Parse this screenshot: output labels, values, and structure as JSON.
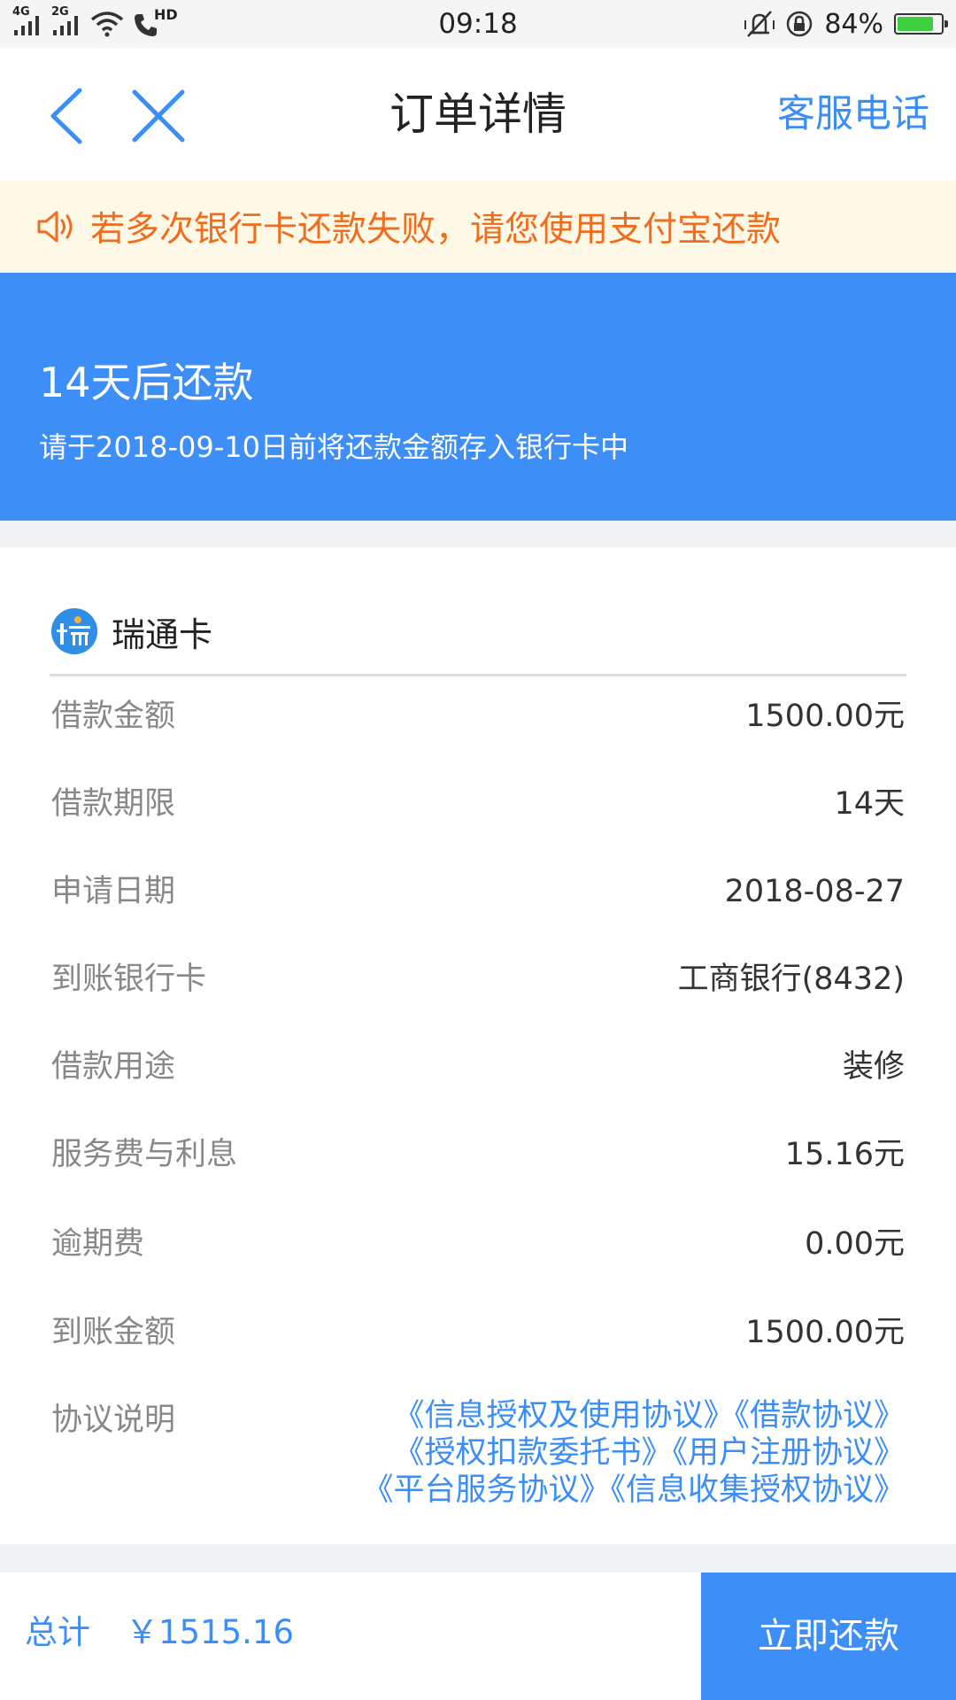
{
  "status_bar": {
    "time": "09:18",
    "battery": "84%",
    "battery_level": 0.84,
    "network_1": "4G",
    "network_2": "2G",
    "call_badge": "HD"
  },
  "nav": {
    "title": "订单详情",
    "right_link": "客服电话"
  },
  "notice": {
    "text": "若多次银行卡还款失败，请您使用支付宝还款"
  },
  "banner": {
    "title": "14天后还款",
    "subtitle": "请于2018-09-10日前将还款金额存入银行卡中"
  },
  "card": {
    "name": "瑞通卡",
    "rows": [
      {
        "label": "借款金额",
        "value": "1500.00元"
      },
      {
        "label": "借款期限",
        "value": "14天"
      },
      {
        "label": "申请日期",
        "value": "2018-08-27"
      },
      {
        "label": "到账银行卡",
        "value": "工商银行(8432)"
      },
      {
        "label": "借款用途",
        "value": "装修"
      },
      {
        "label": "服务费与利息",
        "value": "15.16元"
      },
      {
        "label": "逾期费",
        "value": "0.00元"
      },
      {
        "label": "到账金额",
        "value": "1500.00元"
      }
    ],
    "agreements_label": "协议说明",
    "agreements": [
      "《信息授权及使用协议》",
      "《借款协议》",
      "《授权扣款委托书》",
      "《用户注册协议》",
      "《平台服务协议》",
      "《信息收集授权协议》"
    ]
  },
  "footer": {
    "total_label": "总计",
    "total_value": "￥1515.16",
    "pay_button": "立即还款"
  },
  "colors": {
    "accent": "#3d8ef7",
    "link": "#3a8ef6",
    "warning": "#f06d1f",
    "notice_bg": "#fef8e6"
  }
}
